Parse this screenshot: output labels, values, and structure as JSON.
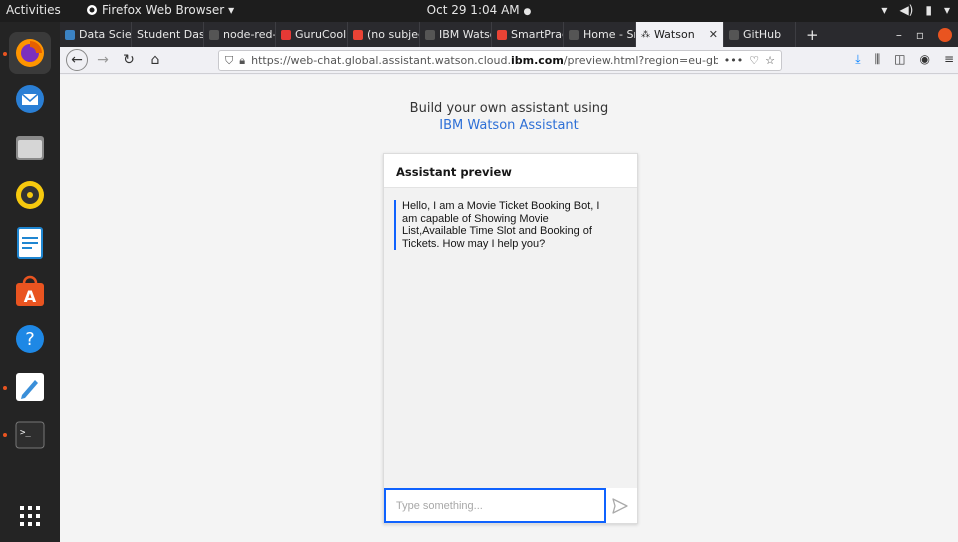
{
  "system": {
    "activities": "Activities",
    "app_name": "Firefox Web Browser",
    "clock": "Oct 29  1:04 AM",
    "record_dot": "●"
  },
  "dock": {
    "items": [
      {
        "name": "firefox-icon",
        "color": "#e66000"
      },
      {
        "name": "thunderbird-icon",
        "color": "#2a7fd5"
      },
      {
        "name": "files-icon",
        "color": "#6f6f6f"
      },
      {
        "name": "rhythmbox-icon",
        "color": "#f6c90e"
      },
      {
        "name": "writer-icon",
        "color": "#1f86d1"
      },
      {
        "name": "software-icon",
        "color": "#e95420"
      },
      {
        "name": "help-icon",
        "color": "#1e88e5"
      },
      {
        "name": "text-editor-icon",
        "color": "#3a8fd9"
      },
      {
        "name": "terminal-icon",
        "color": "#2e2e2e"
      }
    ],
    "apps_grid": "apps-grid-icon"
  },
  "browser": {
    "tabs": [
      {
        "label": "Data Scien",
        "color": "#3b82c4",
        "active": false
      },
      {
        "label": "Student Dash",
        "color": "#555555",
        "active": false
      },
      {
        "label": "node-red-l",
        "color": "#555555",
        "active": false
      },
      {
        "label": "GuruCool",
        "color": "#e53935",
        "active": false
      },
      {
        "label": "(no subjec",
        "color": "#ea4335",
        "active": false
      },
      {
        "label": "IBM Watso",
        "color": "#555555",
        "active": false
      },
      {
        "label": "SmartPrac",
        "color": "#ea4335",
        "active": false
      },
      {
        "label": "Home - Sm",
        "color": "#555555",
        "active": false
      },
      {
        "label": "Watson",
        "color": "#444444",
        "active": true
      },
      {
        "label": "GitHub",
        "color": "#555555",
        "active": false
      }
    ],
    "new_tab": "+",
    "url_prefix": "https://web-chat.global.assistant.watson.cloud.",
    "url_domain": "ibm.com",
    "url_suffix": "/preview.html?region=eu-gb&integra",
    "url_more": "•••"
  },
  "page": {
    "heading_line1": "Build your own assistant using",
    "heading_brand": "IBM Watson Assistant",
    "widget_title": "Assistant preview",
    "bot_message": "Hello, I am a Movie Ticket Booking Bot, I am capable of Showing Movie List,Available Time Slot and Booking of Tickets. How may I help you?",
    "input_placeholder": "Type something...",
    "accent_color": "#0f62fe",
    "brand_color": "#2d6fd6"
  }
}
